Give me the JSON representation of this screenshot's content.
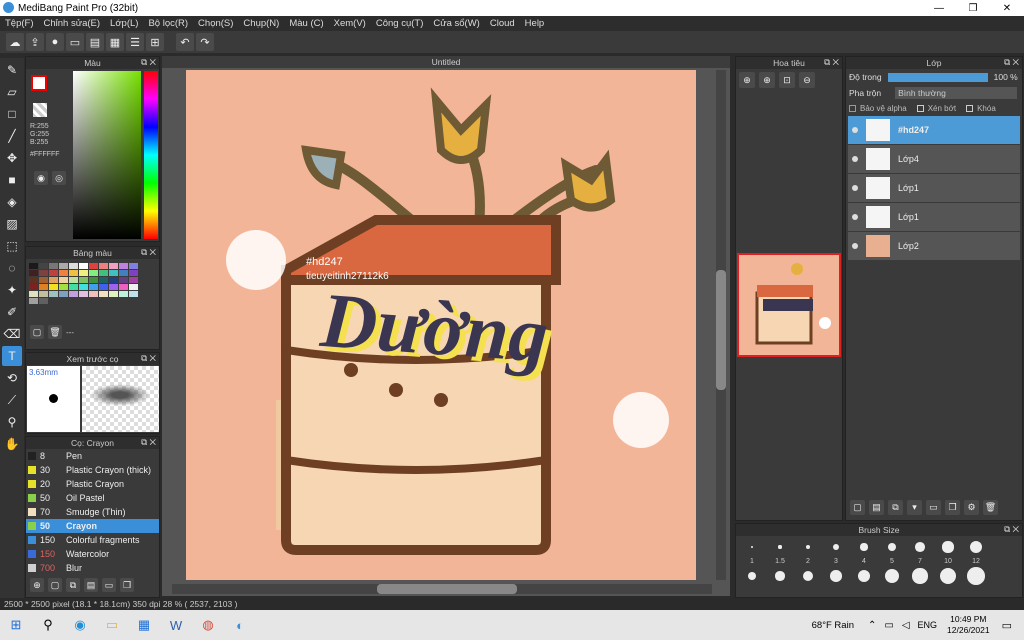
{
  "window": {
    "title": "MediBang Paint Pro (32bit)"
  },
  "menu": [
    "Tệp(F)",
    "Chỉnh sửa(E)",
    "Lớp(L)",
    "Bộ lọc(R)",
    "Chọn(S)",
    "Chụp(N)",
    "Màu (C)",
    "Xem(V)",
    "Công cụ(T)",
    "Cửa sổ(W)",
    "Cloud",
    "Help"
  ],
  "color_panel": {
    "title": "Màu",
    "rgb": [
      "R:255",
      "G:255",
      "B:255"
    ],
    "hex": "#FFFFFF"
  },
  "swatch_panel": {
    "title": "Bảng màu",
    "placeholder": "---"
  },
  "preview_panel": {
    "title": "Xem trước cọ",
    "size": "3.63mm"
  },
  "brush_panel": {
    "title": "Cọ: Crayon",
    "items": [
      {
        "size": "8",
        "name": "Pen",
        "color": "#222222"
      },
      {
        "size": "30",
        "name": "Plastic Crayon (thick)",
        "color": "#e6e22a"
      },
      {
        "size": "20",
        "name": "Plastic Crayon",
        "color": "#e6e22a"
      },
      {
        "size": "50",
        "name": "Oil Pastel",
        "color": "#8ad04a"
      },
      {
        "size": "70",
        "name": "Smudge (Thin)",
        "color": "#f0e0c0"
      },
      {
        "size": "50",
        "name": "Crayon",
        "color": "#8ad04a"
      },
      {
        "size": "150",
        "name": "Colorful fragments",
        "color": "#3a8fd8"
      },
      {
        "size": "150",
        "name": "Watercolor",
        "color": "#3a6ad8"
      },
      {
        "size": "700",
        "name": "Blur",
        "color": "#cfcfcf"
      }
    ]
  },
  "canvas": {
    "tab": "Untitled",
    "text1": "#hd247",
    "text2": "tieuyeitinh27112k6",
    "title_art": "Dường"
  },
  "navigator": {
    "title": "Hoa tiêu"
  },
  "layers": {
    "title": "Lớp",
    "opacity_label": "Độ trong",
    "opacity": "100 %",
    "blend_label": "Pha trộn",
    "blend_value": "Bình thường",
    "protect_alpha": "Bảo vệ alpha",
    "clip": "Xén bớt",
    "lock": "Khóa",
    "items": [
      {
        "name": "#hd247",
        "selected": true
      },
      {
        "name": "Lớp4"
      },
      {
        "name": "Lớp1"
      },
      {
        "name": "Lớp1"
      },
      {
        "name": "Lớp2"
      }
    ]
  },
  "brush_size": {
    "title": "Brush Size",
    "values": [
      "1",
      "1.5",
      "2",
      "3",
      "4",
      "5",
      "7",
      "10",
      "12"
    ]
  },
  "status": "2500 * 2500 pixel  (18.1 * 18.1cm)  350 dpi  28 %  ( 2537, 2103 )",
  "taskbar": {
    "weather": "68°F Rain",
    "lang": "ENG",
    "time": "10:49 PM",
    "date": "12/26/2021"
  }
}
